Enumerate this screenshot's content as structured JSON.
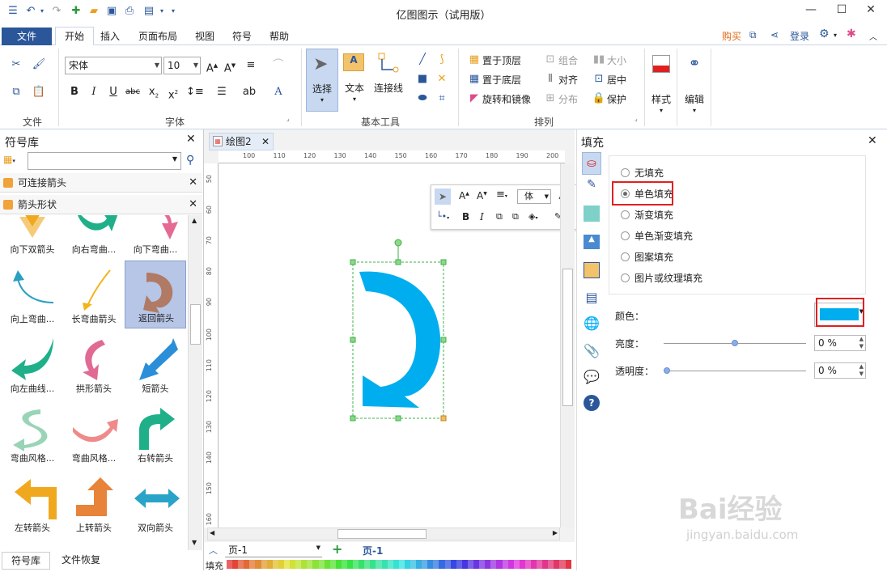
{
  "app": {
    "title": "亿图图示（试用版）"
  },
  "menu": {
    "file": "文件",
    "tabs": [
      "开始",
      "插入",
      "页面布局",
      "视图",
      "符号",
      "帮助"
    ],
    "buy": "购买",
    "login": "登录"
  },
  "ribbon": {
    "groups": {
      "file": "文件",
      "font": "字体",
      "basic_tools": "基本工具",
      "arrange": "排列"
    },
    "font_name": "宋体",
    "font_size": "10",
    "select": "选择",
    "text": "文本",
    "connector": "连接线",
    "bring_front": "置于顶层",
    "send_back": "置于底层",
    "rotate_mirror": "旋转和镜像",
    "combine": "组合",
    "size": "大小",
    "align": "对齐",
    "center": "居中",
    "distribute": "分布",
    "protect": "保护",
    "style": "样式",
    "edit": "编辑"
  },
  "library": {
    "title": "符号库",
    "sections": [
      "可连接箭头",
      "箭头形状"
    ],
    "shapes": [
      {
        "label": "向下双箭头",
        "color": "#f0a81e"
      },
      {
        "label": "向右弯曲...",
        "color": "#1fb08a"
      },
      {
        "label": "向下弯曲...",
        "color": "#e46a94"
      },
      {
        "label": "向上弯曲...",
        "color": "#2a9fc0"
      },
      {
        "label": "长弯曲箭头",
        "color": "#f2b51a"
      },
      {
        "label": "返回箭头",
        "color": "#b07a64"
      },
      {
        "label": "向左曲线...",
        "color": "#1fb08a"
      },
      {
        "label": "拱形箭头",
        "color": "#e06a94"
      },
      {
        "label": "短箭头",
        "color": "#2a8fd8"
      },
      {
        "label": "弯曲风格...",
        "color": "#7fc9a5"
      },
      {
        "label": "弯曲风格...",
        "color": "#f08a8a"
      },
      {
        "label": "右转箭头",
        "color": "#1fb08a"
      },
      {
        "label": "左转箭头",
        "color": "#f0a81e"
      },
      {
        "label": "上转箭头",
        "color": "#e8833a"
      },
      {
        "label": "双向箭头",
        "color": "#2aa3c8"
      }
    ],
    "bottom_tabs": [
      "符号库",
      "文件恢复"
    ]
  },
  "canvas": {
    "doc_tab": "绘图2",
    "ruler_h": [
      "100",
      "110",
      "120",
      "130",
      "140",
      "150",
      "160",
      "170",
      "180",
      "190",
      "200"
    ],
    "ruler_v": [
      "50",
      "60",
      "70",
      "80",
      "90",
      "100",
      "110",
      "120",
      "130",
      "140",
      "150",
      "160"
    ],
    "mini_font": "体",
    "page_select": "页-1",
    "page_tab": "页-1",
    "fill_label": "填充",
    "shape_color": "#00aeef"
  },
  "fill_panel": {
    "title": "填充",
    "options": [
      "无填充",
      "单色填充",
      "渐变填充",
      "单色渐变填充",
      "图案填充",
      "图片或纹理填充"
    ],
    "selected": "单色填充",
    "color_label": "颜色：",
    "color_value": "#00aeef",
    "brightness_label": "亮度：",
    "brightness_value": "0 %",
    "transparency_label": "透明度：",
    "transparency_value": "0 %"
  },
  "watermark": {
    "brand": "Bai经验",
    "url": "jingyan.baidu.com"
  }
}
